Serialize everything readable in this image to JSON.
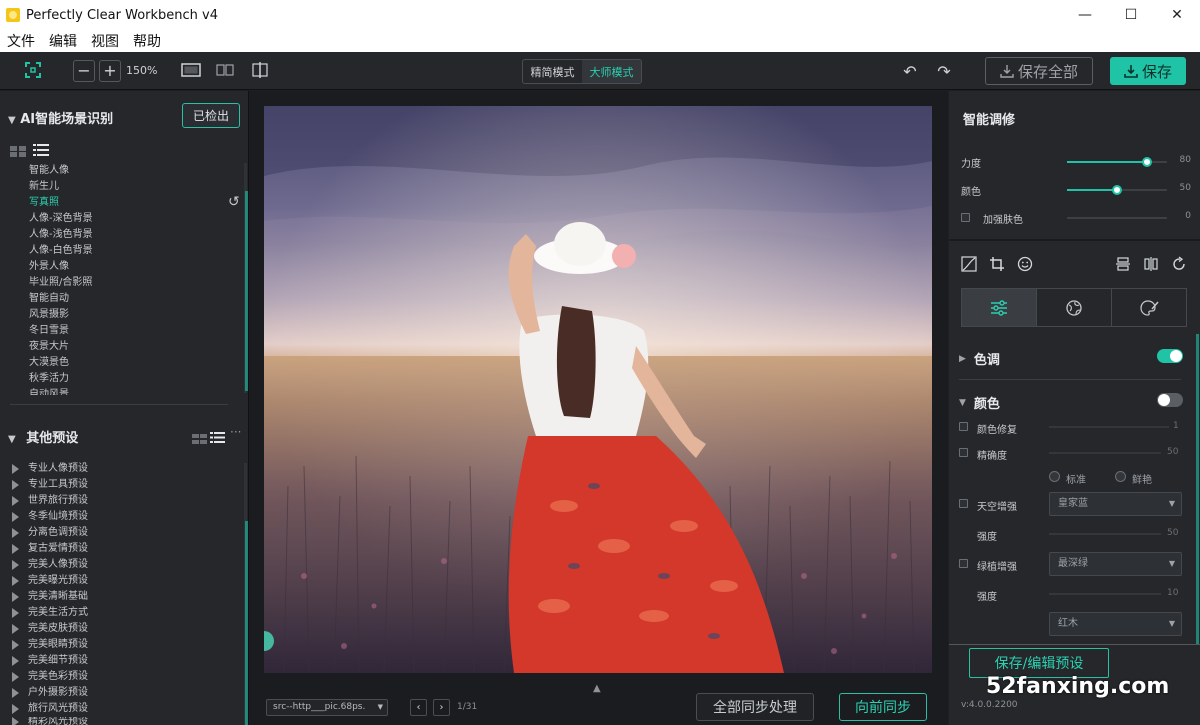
{
  "window": {
    "title": "Perfectly Clear Workbench v4",
    "minimize": "—",
    "maximize": "☐",
    "close": "✕"
  },
  "menu": [
    "文件",
    "编辑",
    "视图",
    "帮助"
  ],
  "toolbar": {
    "zoom_out": "−",
    "zoom_in": "+",
    "zoom_level": "150%",
    "mode_simple": "精简模式",
    "mode_master": "大师模式",
    "save_all": "保存全部",
    "save": "保存",
    "undo": "↶",
    "redo": "↷"
  },
  "left": {
    "scene_title": "AI智能场景识别",
    "detected_btn": "已检出",
    "scenes": [
      "智能人像",
      "新生儿",
      "写真照",
      "人像-深色背景",
      "人像-浅色背景",
      "人像-白色背景",
      "外景人像",
      "毕业照/合影照",
      "智能自动",
      "风景摄影",
      "冬日雪景",
      "夜景大片",
      "大漠景色",
      "秋季活力",
      "自动风景"
    ],
    "active_scene_index": 2,
    "preset_title": "其他预设",
    "presets": [
      "专业人像预设",
      "专业工具预设",
      "世界旅行预设",
      "冬季仙境预设",
      "分离色调预设",
      "复古爱情预设",
      "完美人像预设",
      "完美曝光预设",
      "完美清晰基础",
      "完美生活方式",
      "完美皮肤预设",
      "完美眼睛预设",
      "完美细节预设",
      "完美色彩预设",
      "户外摄影预设",
      "旅行风光预设",
      "精彩风光预设"
    ]
  },
  "center": {
    "source_file": "src--http___pic.68ps.",
    "prev": "‹",
    "next": "›",
    "counter": "1/31",
    "sync_all": "全部同步处理",
    "sync_forward": "向前同步"
  },
  "right": {
    "title": "智能调修",
    "sliders": [
      {
        "label": "力度",
        "value": 80,
        "text": "80"
      },
      {
        "label": "颜色",
        "value": 50,
        "text": "50"
      },
      {
        "label": "加强肤色",
        "value": 0,
        "text": "0"
      }
    ],
    "tone_head": "色调",
    "color_head": "颜色",
    "color_options": [
      {
        "label": "颜色修复",
        "value": "1"
      },
      {
        "label": "精确度",
        "value": "50"
      }
    ],
    "radio_standard": "标准",
    "radio_vivid": "鲜艳",
    "sky_label": "天空增强",
    "sky_dd": "皇家蓝",
    "intensity_label": "强度",
    "sky_intensity": "50",
    "green_label": "绿植增强",
    "green_dd": "最深绿",
    "green_intensity": "10",
    "wood_dd": "红木",
    "preset_btn": "保存/编辑预设",
    "version": "v:4.0.0.2200"
  },
  "watermark": "52fanxing.com",
  "colors": {
    "accent": "#1fc4a6",
    "panel": "#25272b",
    "background": "#1b1c1f"
  }
}
